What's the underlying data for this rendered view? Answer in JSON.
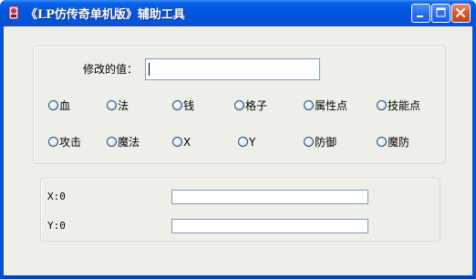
{
  "window": {
    "title": "《LP仿传奇单机版》辅助工具",
    "icon": "app-icon",
    "controls": {
      "minimize": "minimize-icon",
      "maximize": "maximize-icon",
      "close": "close-icon"
    }
  },
  "edit": {
    "label": "修改的值：",
    "value": ""
  },
  "options_row1": [
    {
      "label": "血"
    },
    {
      "label": "法"
    },
    {
      "label": "钱"
    },
    {
      "label": "格子"
    },
    {
      "label": "属性点"
    },
    {
      "label": "技能点"
    }
  ],
  "options_row2": [
    {
      "label": "攻击"
    },
    {
      "label": "魔法"
    },
    {
      "label": "X"
    },
    {
      "label": "Y"
    },
    {
      "label": "防御"
    },
    {
      "label": "魔防"
    }
  ],
  "coords": {
    "x_label": "X:0",
    "y_label": "Y:0",
    "x_value": "",
    "y_value": ""
  },
  "colors": {
    "titlebar": "#0254da",
    "client_bg": "#efefe9",
    "textbox_border": "#7f9db9",
    "radio_border": "#1c5180"
  }
}
